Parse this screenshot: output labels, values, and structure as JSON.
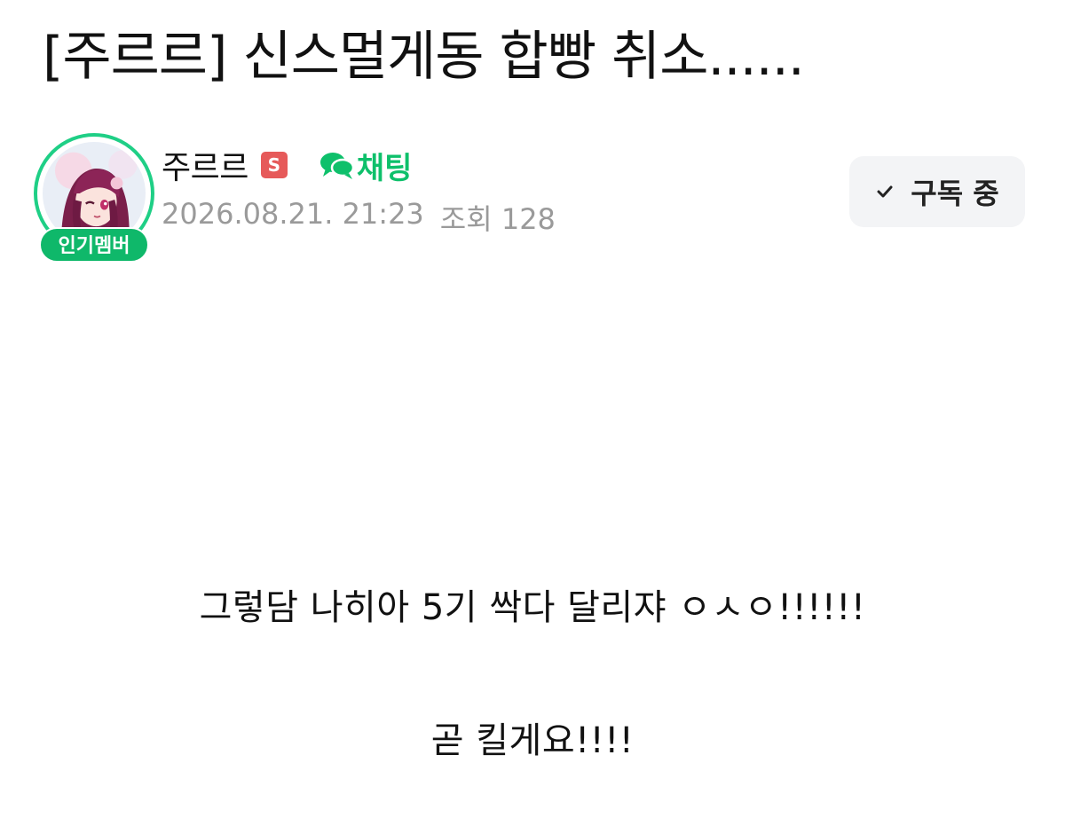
{
  "post": {
    "title": "[주르르] 신스멀게동 합빵 취소......",
    "body_lines": [
      "그렇담 나히아 5기 싹다 달리쟈 ㅇㅅㅇ!!!!!!",
      "곧 킬게요!!!!"
    ]
  },
  "author": {
    "name": "주르르",
    "staff_badge": "S",
    "popular_badge": "인기멤버",
    "avatar_icon": "avatar-anime-girl",
    "chat_label": "채팅",
    "chat_icon": "chat-bubbles-icon"
  },
  "meta": {
    "date": "2026.08.21. 21:23",
    "views": "조회 128"
  },
  "subscribe": {
    "label": "구독 중",
    "icon": "check-icon"
  },
  "colors": {
    "accent_green": "#0ec06b",
    "ring_green": "#1fcf86",
    "badge_green": "#0fb86a",
    "staff_red": "#e65a5a",
    "meta_gray": "#9a9a9a",
    "button_bg": "#f3f4f6"
  }
}
